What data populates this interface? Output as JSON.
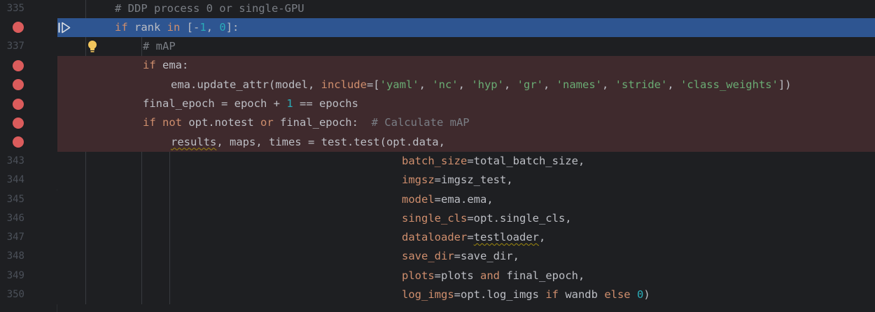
{
  "lines": [
    {
      "num": "335",
      "breakpoint": false,
      "bg": "none",
      "indent": 0,
      "tokens": [
        {
          "t": "# DDP process 0 or single-GPU",
          "c": "cm"
        }
      ]
    },
    {
      "num": "",
      "breakpoint": true,
      "bg": "exec",
      "indent": 0,
      "tokens": [
        {
          "t": "if",
          "c": "kw"
        },
        {
          "t": " rank ",
          "c": ""
        },
        {
          "t": "in",
          "c": "kw"
        },
        {
          "t": " [-",
          "c": ""
        },
        {
          "t": "1",
          "c": "num"
        },
        {
          "t": ", ",
          "c": ""
        },
        {
          "t": "0",
          "c": "num"
        },
        {
          "t": "]:",
          "c": ""
        }
      ]
    },
    {
      "num": "337",
      "breakpoint": false,
      "bg": "none",
      "indent": 1,
      "bulb": true,
      "tokens": [
        {
          "t": "# mAP",
          "c": "cm"
        }
      ]
    },
    {
      "num": "",
      "breakpoint": true,
      "bg": "bp",
      "indent": 1,
      "tokens": [
        {
          "t": "if",
          "c": "kw"
        },
        {
          "t": " ema:",
          "c": ""
        }
      ]
    },
    {
      "num": "",
      "breakpoint": true,
      "bg": "bp",
      "indent": 2,
      "tokens": [
        {
          "t": "ema.update_attr(model, ",
          "c": ""
        },
        {
          "t": "include",
          "c": "kwarg"
        },
        {
          "t": "=[",
          "c": ""
        },
        {
          "t": "'yaml'",
          "c": "str"
        },
        {
          "t": ", ",
          "c": ""
        },
        {
          "t": "'nc'",
          "c": "str"
        },
        {
          "t": ", ",
          "c": ""
        },
        {
          "t": "'hyp'",
          "c": "str"
        },
        {
          "t": ", ",
          "c": ""
        },
        {
          "t": "'gr'",
          "c": "str"
        },
        {
          "t": ", ",
          "c": ""
        },
        {
          "t": "'names'",
          "c": "str"
        },
        {
          "t": ", ",
          "c": ""
        },
        {
          "t": "'stride'",
          "c": "str"
        },
        {
          "t": ", ",
          "c": ""
        },
        {
          "t": "'class_weights'",
          "c": "str"
        },
        {
          "t": "])",
          "c": ""
        }
      ]
    },
    {
      "num": "",
      "breakpoint": true,
      "bg": "bp",
      "indent": 1,
      "tokens": [
        {
          "t": "final_epoch = epoch + ",
          "c": ""
        },
        {
          "t": "1",
          "c": "num"
        },
        {
          "t": " == epochs",
          "c": ""
        }
      ]
    },
    {
      "num": "",
      "breakpoint": true,
      "bg": "bp",
      "indent": 1,
      "tokens": [
        {
          "t": "if not",
          "c": "kw"
        },
        {
          "t": " opt.notest ",
          "c": ""
        },
        {
          "t": "or",
          "c": "kw"
        },
        {
          "t": " final_epoch:  ",
          "c": ""
        },
        {
          "t": "# Calculate mAP",
          "c": "cm"
        }
      ]
    },
    {
      "num": "",
      "breakpoint": true,
      "bg": "bp",
      "indent": 2,
      "tokens": [
        {
          "t": "results",
          "c": "squig"
        },
        {
          "t": ", maps, times = test.test(opt.data,",
          "c": ""
        }
      ]
    },
    {
      "num": "343",
      "breakpoint": false,
      "bg": "none",
      "indent": 0,
      "cont": true,
      "tokens": [
        {
          "t": "batch_size",
          "c": "kwarg"
        },
        {
          "t": "=total_batch_size,",
          "c": ""
        }
      ]
    },
    {
      "num": "344",
      "breakpoint": false,
      "bg": "none",
      "indent": 0,
      "cont": true,
      "tokens": [
        {
          "t": "imgsz",
          "c": "kwarg"
        },
        {
          "t": "=imgsz_test,",
          "c": ""
        }
      ]
    },
    {
      "num": "345",
      "breakpoint": false,
      "bg": "none",
      "indent": 0,
      "cont": true,
      "tokens": [
        {
          "t": "model",
          "c": "kwarg"
        },
        {
          "t": "=ema.ema,",
          "c": ""
        }
      ]
    },
    {
      "num": "346",
      "breakpoint": false,
      "bg": "none",
      "indent": 0,
      "cont": true,
      "tokens": [
        {
          "t": "single_cls",
          "c": "kwarg"
        },
        {
          "t": "=opt.single_cls,",
          "c": ""
        }
      ]
    },
    {
      "num": "347",
      "breakpoint": false,
      "bg": "none",
      "indent": 0,
      "cont": true,
      "tokens": [
        {
          "t": "dataloader",
          "c": "kwarg"
        },
        {
          "t": "=",
          "c": ""
        },
        {
          "t": "testloader",
          "c": "squig"
        },
        {
          "t": ",",
          "c": ""
        }
      ]
    },
    {
      "num": "348",
      "breakpoint": false,
      "bg": "none",
      "indent": 0,
      "cont": true,
      "tokens": [
        {
          "t": "save_dir",
          "c": "kwarg"
        },
        {
          "t": "=save_dir,",
          "c": ""
        }
      ]
    },
    {
      "num": "349",
      "breakpoint": false,
      "bg": "none",
      "indent": 0,
      "cont": true,
      "tokens": [
        {
          "t": "plots",
          "c": "kwarg"
        },
        {
          "t": "=plots ",
          "c": ""
        },
        {
          "t": "and",
          "c": "kw"
        },
        {
          "t": " final_epoch,",
          "c": ""
        }
      ]
    },
    {
      "num": "350",
      "breakpoint": false,
      "bg": "none",
      "indent": 0,
      "cont": true,
      "tokens": [
        {
          "t": "log_imgs",
          "c": "kwarg"
        },
        {
          "t": "=opt.log_imgs ",
          "c": ""
        },
        {
          "t": "if",
          "c": "kw"
        },
        {
          "t": " wandb ",
          "c": ""
        },
        {
          "t": "else",
          "c": "kw"
        },
        {
          "t": " ",
          "c": ""
        },
        {
          "t": "0",
          "c": "num"
        },
        {
          "t": ")",
          "c": ""
        }
      ]
    }
  ]
}
